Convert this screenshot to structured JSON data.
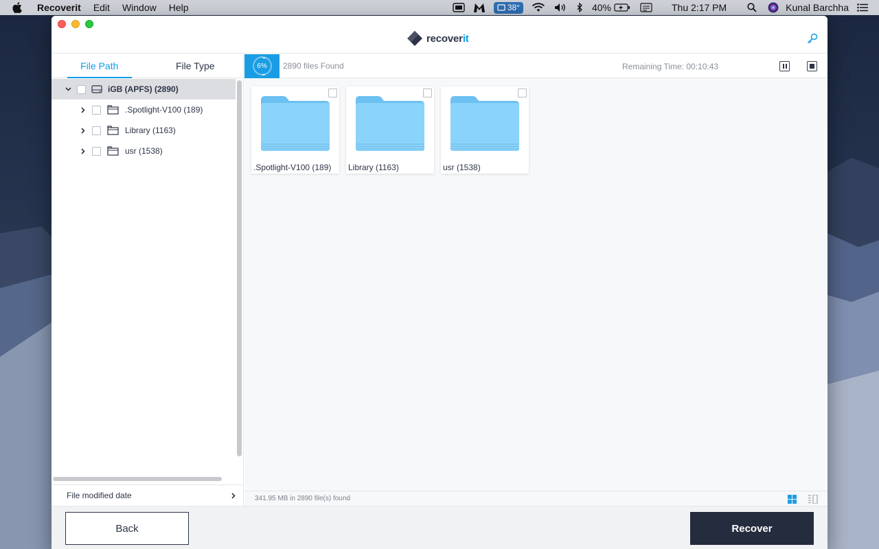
{
  "menubar": {
    "app_name": "Recoverit",
    "menus": [
      "Edit",
      "Window",
      "Help"
    ],
    "temperature": "38°",
    "battery": "40%",
    "clock": "Thu 2:17 PM",
    "user": "Kunal Barchha"
  },
  "window": {
    "logo_prefix": "recover",
    "logo_suffix": "it"
  },
  "left_panel": {
    "tabs": [
      {
        "label": "File Path",
        "active": true
      },
      {
        "label": "File Type",
        "active": false
      }
    ],
    "tree": {
      "root": "iGB (APFS) (2890)",
      "children": [
        {
          "label": ".Spotlight-V100 (189)"
        },
        {
          "label": "Library (1163)"
        },
        {
          "label": "usr (1538)"
        }
      ]
    },
    "filter_label": "File modified date"
  },
  "scan": {
    "progress_label": "6%",
    "progress": 0.06,
    "found": "2890 files Found",
    "remaining": "Remaining Time: 00:10:43"
  },
  "grid": {
    "items": [
      {
        "label": ".Spotlight-V100 (189)"
      },
      {
        "label": "Library (1163)"
      },
      {
        "label": "usr (1538)"
      }
    ]
  },
  "summary": "341.95 MB in 2890 file(s) found",
  "footer": {
    "back_label": "Back",
    "recover_label": "Recover"
  },
  "colors": {
    "accent": "#1a9de4",
    "dark": "#252c3d"
  }
}
